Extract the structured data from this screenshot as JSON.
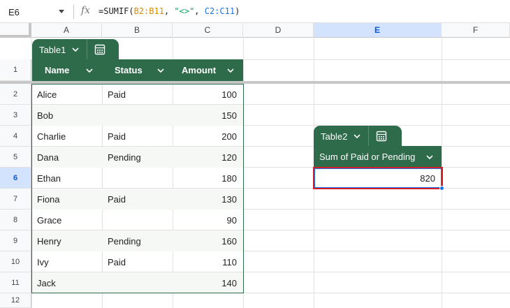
{
  "formula_bar": {
    "cell_ref": "E6",
    "fx_label": "fx",
    "formula_prefix": "=SUMIF(",
    "arg1": "B2:B11",
    "sep1": ", ",
    "arg2": "\"<>\"",
    "sep2": ", ",
    "arg3": "C2:C11",
    "formula_suffix": ")"
  },
  "columns": [
    "A",
    "B",
    "C",
    "D",
    "E",
    "F"
  ],
  "selected_column": "E",
  "rows": [
    "1",
    "2",
    "3",
    "4",
    "5",
    "6",
    "7",
    "8",
    "9",
    "10",
    "11",
    "12"
  ],
  "selected_row": "6",
  "table1": {
    "name": "Table1",
    "headers": [
      "Name",
      "Status",
      "Amount"
    ],
    "rows": [
      {
        "name": "Alice",
        "status": "Paid",
        "amount": "100"
      },
      {
        "name": "Bob",
        "status": "",
        "amount": "150"
      },
      {
        "name": "Charlie",
        "status": "Paid",
        "amount": "200"
      },
      {
        "name": "Dana",
        "status": "Pending",
        "amount": "120"
      },
      {
        "name": "Ethan",
        "status": "",
        "amount": "180"
      },
      {
        "name": "Fiona",
        "status": "Paid",
        "amount": "130"
      },
      {
        "name": "Grace",
        "status": "",
        "amount": "90"
      },
      {
        "name": "Henry",
        "status": "Pending",
        "amount": "160"
      },
      {
        "name": "Ivy",
        "status": "Paid",
        "amount": "110"
      },
      {
        "name": "Jack",
        "status": "",
        "amount": "140"
      }
    ]
  },
  "table2": {
    "name": "Table2",
    "header": "Sum of Paid or Pending",
    "value": "820"
  },
  "colors": {
    "table_green": "#2e6b4a",
    "selection_blue": "#1a73e8",
    "highlight_red": "#d21f26"
  }
}
